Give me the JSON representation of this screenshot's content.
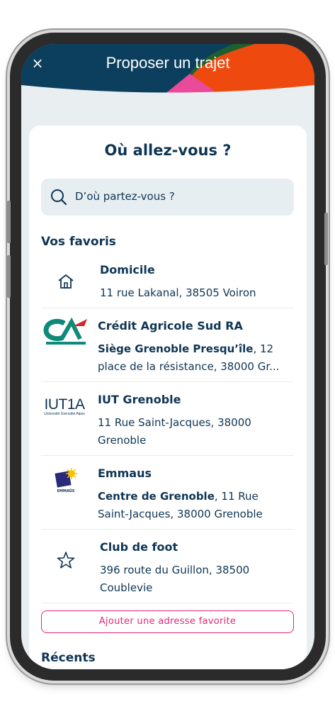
{
  "header": {
    "title": "Proposer un trajet",
    "close_label": "×"
  },
  "card": {
    "title": "Où allez-vous ?"
  },
  "search": {
    "placeholder": "D’où partez-vous ?",
    "icon": "search-icon"
  },
  "favorites": {
    "section_title": "Vos favoris",
    "items": [
      {
        "icon": "home-icon",
        "name": "Domicile",
        "address_bold": "",
        "address": "11 rue Lakanal, 38505 Voiron"
      },
      {
        "icon": "credit-agricole-logo",
        "name": "Crédit Agricole Sud RA",
        "address_bold": "Siège Grenoble Presqu’île",
        "address": ", 12 place de la résistance, 38000 Gr..."
      },
      {
        "icon": "iut1a-logo",
        "logo_text": "IUT1A",
        "logo_subtext": "Université Grenoble Alpes",
        "name": "IUT Grenoble",
        "address_bold": "",
        "address": "11 Rue Saint-Jacques, 38000 Grenoble"
      },
      {
        "icon": "emmaus-logo",
        "logo_text": "EMMAÜS",
        "name": "Emmaus",
        "address_bold": "Centre de Grenoble",
        "address": ", 11 Rue Saint-Jacques, 38000 Grenoble"
      },
      {
        "icon": "star-icon",
        "name": "Club de foot",
        "address_bold": "",
        "address": "396 route du Guillon, 38500 Coublevie"
      }
    ],
    "add_label": "Ajouter une adresse favorite"
  },
  "recents": {
    "section_title": "Récents"
  },
  "colors": {
    "navy": "#0f3554",
    "accent": "#e5257a",
    "header_blue": "#0c3f5e",
    "header_orange": "#ee4a10",
    "header_pink": "#ea4a9a",
    "header_green": "#1f5f2e"
  }
}
